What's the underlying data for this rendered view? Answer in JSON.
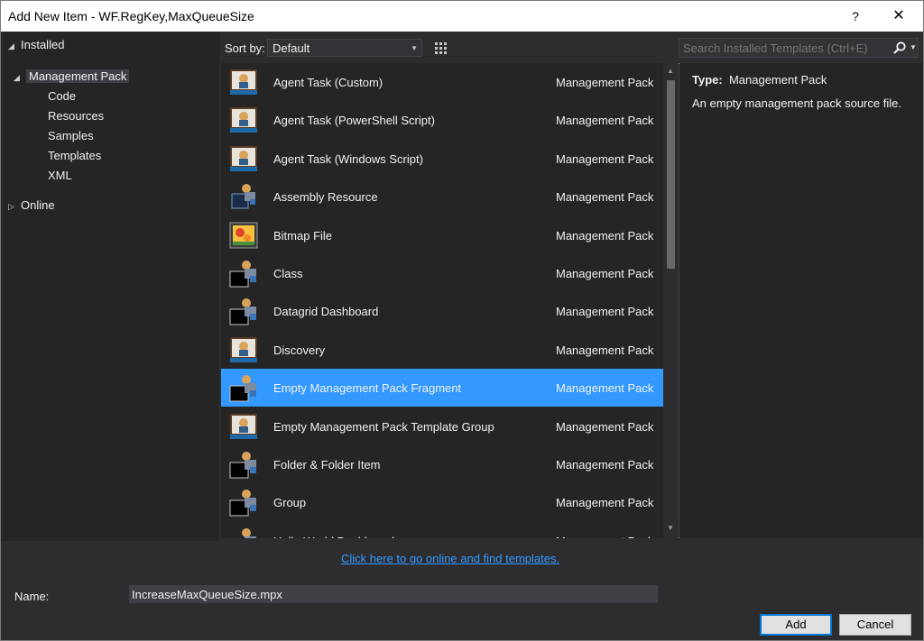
{
  "window": {
    "title": "Add New Item - WF.RegKey,MaxQueueSize",
    "help": "?",
    "close": "✕"
  },
  "tree": {
    "installed": "Installed",
    "management_pack": "Management Pack",
    "children": [
      "Code",
      "Resources",
      "Samples",
      "Templates",
      "XML"
    ],
    "online": "Online"
  },
  "toolbar": {
    "sort_label": "Sort by:",
    "sort_value": "Default"
  },
  "search": {
    "placeholder": "Search Installed Templates (Ctrl+E)"
  },
  "items": [
    {
      "name": "Agent Task (Custom)",
      "type": "Management Pack",
      "icon": "agent-task-icon"
    },
    {
      "name": "Agent Task (PowerShell Script)",
      "type": "Management Pack",
      "icon": "agent-task-icon"
    },
    {
      "name": "Agent Task (Windows Script)",
      "type": "Management Pack",
      "icon": "agent-task-icon"
    },
    {
      "name": "Assembly Resource",
      "type": "Management Pack",
      "icon": "assembly-resource-icon"
    },
    {
      "name": "Bitmap File",
      "type": "Management Pack",
      "icon": "bitmap-file-icon"
    },
    {
      "name": "Class",
      "type": "Management Pack",
      "icon": "management-pack-fragment-icon"
    },
    {
      "name": "Datagrid Dashboard",
      "type": "Management Pack",
      "icon": "management-pack-fragment-icon"
    },
    {
      "name": "Discovery",
      "type": "Management Pack",
      "icon": "agent-task-icon"
    },
    {
      "name": "Empty Management Pack Fragment",
      "type": "Management Pack",
      "icon": "management-pack-fragment-icon",
      "selected": true
    },
    {
      "name": "Empty Management Pack Template Group",
      "type": "Management Pack",
      "icon": "agent-task-icon"
    },
    {
      "name": "Folder & Folder Item",
      "type": "Management Pack",
      "icon": "management-pack-fragment-icon"
    },
    {
      "name": "Group",
      "type": "Management Pack",
      "icon": "management-pack-fragment-icon"
    },
    {
      "name": "Hello World Dashboard",
      "type": "Management Pack",
      "icon": "management-pack-fragment-icon"
    }
  ],
  "details": {
    "type_label": "Type:",
    "type_value": "Management Pack",
    "description": "An empty management pack source file."
  },
  "online_link": "Click here to go online and find templates.",
  "name_field": {
    "label": "Name:",
    "value": "IncreaseMaxQueueSize.mpx"
  },
  "buttons": {
    "add": "Add",
    "cancel": "Cancel"
  },
  "colors": {
    "accent": "#3399ff",
    "background": "#2d2d30",
    "panel": "#252526"
  }
}
